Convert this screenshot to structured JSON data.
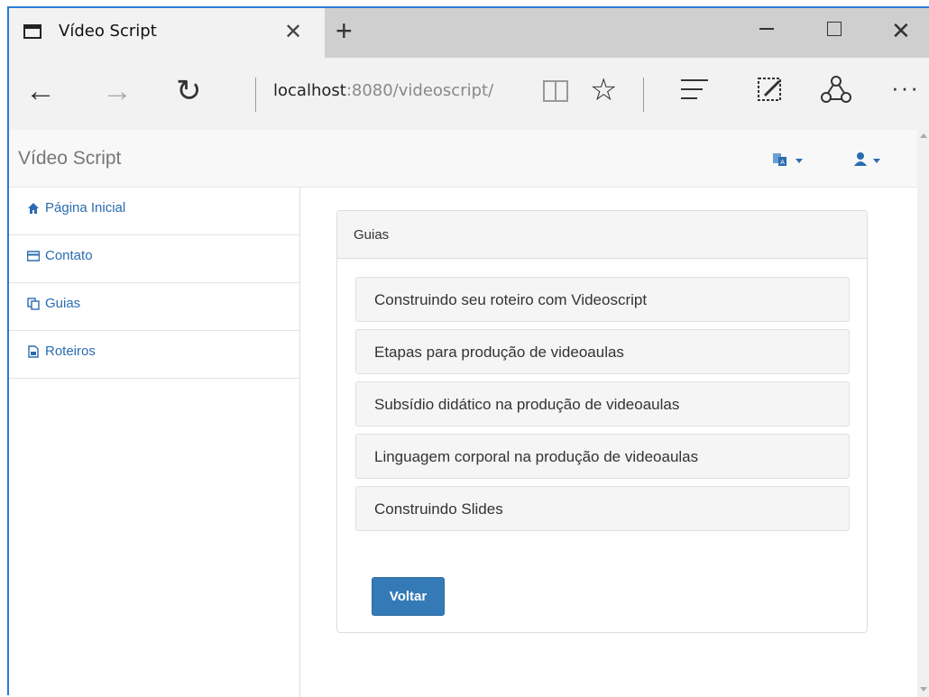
{
  "browser": {
    "tab_title": "Vídeo Script",
    "url_host": "localhost",
    "url_rest": ":8080/videoscript/"
  },
  "app": {
    "brand": "Vídeo Script"
  },
  "sidebar": {
    "items": [
      {
        "label": "Página Inicial",
        "icon": "home-icon"
      },
      {
        "label": "Contato",
        "icon": "card-icon"
      },
      {
        "label": "Guias",
        "icon": "copy-icon"
      },
      {
        "label": "Roteiros",
        "icon": "file-icon"
      }
    ]
  },
  "panel": {
    "heading": "Guias",
    "guides": [
      "Construindo seu roteiro com Videoscript",
      "Etapas para produção de videoaulas",
      "Subsídio didático na produção de videoaulas",
      "Linguagem corporal na produção de videoaulas",
      "Construindo Slides"
    ],
    "back_label": "Voltar"
  },
  "colors": {
    "accent": "#337ab7",
    "link": "#2a6cb0",
    "window_border": "#2b7cd3"
  }
}
